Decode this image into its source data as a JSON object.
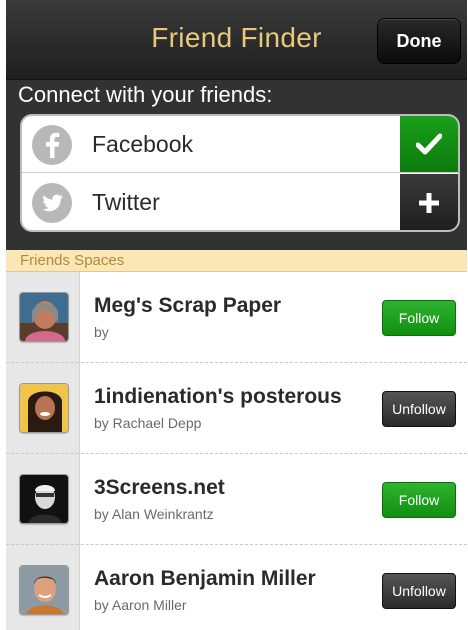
{
  "nav": {
    "title": "Friend Finder",
    "done_label": "Done"
  },
  "connect": {
    "header": "Connect with your friends:",
    "services": [
      {
        "label": "Facebook",
        "icon": "facebook-icon",
        "state": "connected",
        "toggle_icon": "checkmark-icon"
      },
      {
        "label": "Twitter",
        "icon": "twitter-bird-icon",
        "state": "not-connected",
        "toggle_icon": "plus-icon"
      }
    ]
  },
  "section": {
    "title": "Friends Spaces"
  },
  "friends": [
    {
      "name": "Meg's Scrap Paper",
      "author": "by",
      "action": "Follow"
    },
    {
      "name": "1indienation's posterous",
      "author": "by Rachael Depp",
      "action": "Unfollow"
    },
    {
      "name": "3Screens.net",
      "author": "by Alan Weinkrantz",
      "action": "Follow"
    },
    {
      "name": "Aaron Benjamin Miller",
      "author": "by Aaron Miller",
      "action": "Unfollow"
    }
  ],
  "colors": {
    "title_gold": "#e8c879",
    "follow_green": "#1aa01a",
    "section_bar": "#fbe6b8",
    "section_text": "#b08b3a"
  }
}
